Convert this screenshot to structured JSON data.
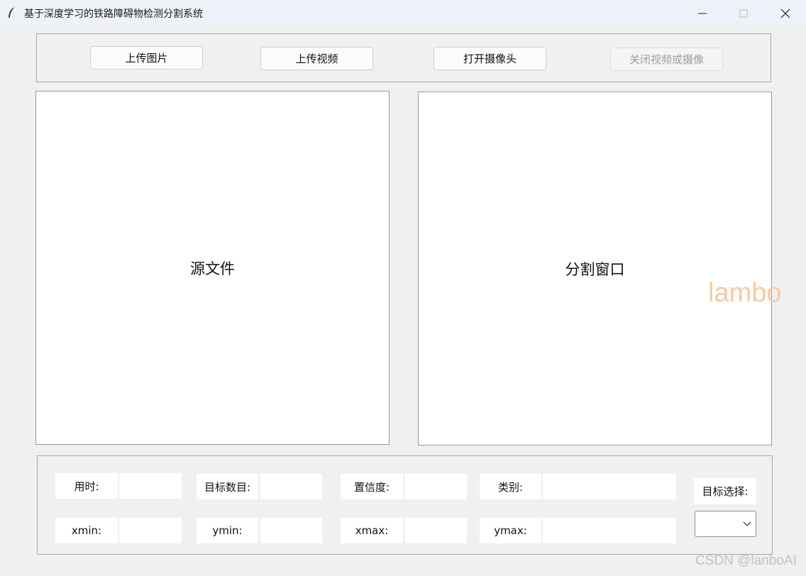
{
  "window": {
    "title": "基于深度学习的铁路障碍物检测分割系统",
    "app_icon": "feather-icon",
    "controls": [
      "minimize-icon",
      "maximize-icon",
      "close-icon"
    ]
  },
  "toolbar": {
    "upload_image": "上传图片",
    "upload_video": "上传视频",
    "open_camera": "打开摄像头",
    "close_video_camera": "关闭视频或摄像"
  },
  "panels": {
    "source_label": "源文件",
    "segment_label": "分割窗口"
  },
  "overlay": {
    "watermark": "lambo",
    "csdn_watermark": "CSDN @lanboAI"
  },
  "stats": {
    "time_label": "用时:",
    "target_count_label": "目标数目:",
    "confidence_label": "置信度:",
    "class_label": "类别:",
    "xmin_label": "xmin:",
    "ymin_label": "ymin:",
    "xmax_label": "xmax:",
    "ymax_label": "ymax:",
    "time_value": "",
    "target_count_value": "",
    "confidence_value": "",
    "class_value": "",
    "xmin_value": "",
    "ymin_value": "",
    "xmax_value": "",
    "ymax_value": ""
  },
  "target_select": {
    "label": "目标选择:",
    "selected": ""
  },
  "colors": {
    "background": "#f0f0f0",
    "titlebar": "#eef2f8",
    "watermark": "#f7c9a3"
  }
}
